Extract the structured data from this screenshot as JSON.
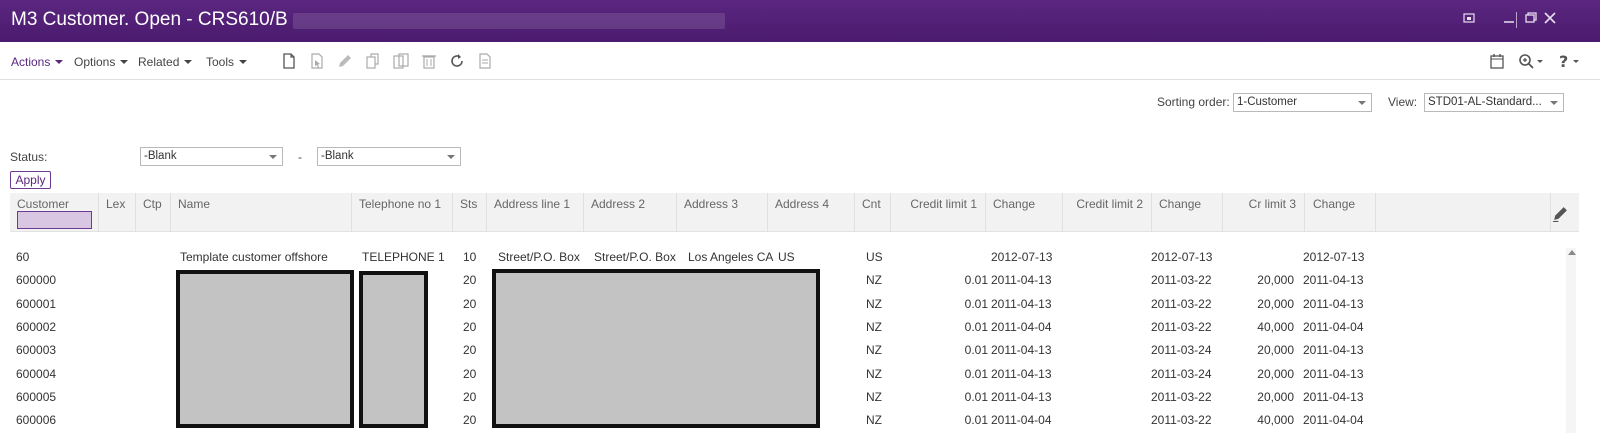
{
  "window": {
    "title": "M3 Customer. Open - CRS610/B"
  },
  "menus": [
    "Actions",
    "Options",
    "Related",
    "Tools"
  ],
  "toolbar_icons": [
    "new-icon",
    "open-icon",
    "edit-icon",
    "copy-icon",
    "copy-alt-icon",
    "delete-icon",
    "refresh-icon",
    "display-icon"
  ],
  "right_icons": [
    "calendar-icon",
    "zoom-icon",
    "help-icon"
  ],
  "sorting": {
    "label": "Sorting order:",
    "value": "1-Customer"
  },
  "view": {
    "label": "View:",
    "value": "STD01-AL-Standard..."
  },
  "status": {
    "label": "Status:",
    "from": "-Blank",
    "separator": "-",
    "to": "-Blank"
  },
  "apply_label": "Apply",
  "columns": [
    "Customer",
    "Lex",
    "Ctp",
    "Name",
    "Telephone no 1",
    "Sts",
    "Address line 1",
    "Address 2",
    "Address 3",
    "Address 4",
    "Cnt",
    "Credit limit 1",
    "Change",
    "Credit limit 2",
    "Change",
    "Cr limit 3",
    "Change"
  ],
  "rows": [
    {
      "customer": "60",
      "name": "Template customer offshore",
      "phone": "TELEPHONE 1",
      "sts": "10",
      "addr1": "Street/P.O. Box",
      "addr2": "Street/P.O. Box",
      "addr3": "Los Angeles CA",
      "addr4": "US",
      "cnt": "US",
      "cl1": "",
      "chg1": "2012-07-13",
      "cl2": "",
      "chg2": "2012-07-13",
      "cl3": "",
      "chg3": "2012-07-13"
    },
    {
      "customer": "600000",
      "name": "",
      "phone": "",
      "sts": "20",
      "addr1": "",
      "addr2": "",
      "addr3": "",
      "addr4": "",
      "cnt": "NZ",
      "cl1": "0.01",
      "chg1": "2011-04-13",
      "cl2": "",
      "chg2": "2011-03-22",
      "cl3": "20,000",
      "chg3": "2011-04-13"
    },
    {
      "customer": "600001",
      "name": "",
      "phone": "",
      "sts": "20",
      "addr1": "",
      "addr2": "",
      "addr3": "",
      "addr4": "",
      "cnt": "NZ",
      "cl1": "0.01",
      "chg1": "2011-04-13",
      "cl2": "",
      "chg2": "2011-03-22",
      "cl3": "20,000",
      "chg3": "2011-04-13"
    },
    {
      "customer": "600002",
      "name": "",
      "phone": "",
      "sts": "20",
      "addr1": "",
      "addr2": "",
      "addr3": "",
      "addr4": "",
      "cnt": "NZ",
      "cl1": "0.01",
      "chg1": "2011-04-04",
      "cl2": "",
      "chg2": "2011-03-22",
      "cl3": "40,000",
      "chg3": "2011-04-04"
    },
    {
      "customer": "600003",
      "name": "",
      "phone": "",
      "sts": "20",
      "addr1": "",
      "addr2": "",
      "addr3": "",
      "addr4": "",
      "cnt": "NZ",
      "cl1": "0.01",
      "chg1": "2011-04-13",
      "cl2": "",
      "chg2": "2011-03-24",
      "cl3": "20,000",
      "chg3": "2011-04-13"
    },
    {
      "customer": "600004",
      "name": "",
      "phone": "",
      "sts": "20",
      "addr1": "",
      "addr2": "",
      "addr3": "",
      "addr4": "",
      "cnt": "NZ",
      "cl1": "0.01",
      "chg1": "2011-04-13",
      "cl2": "",
      "chg2": "2011-03-24",
      "cl3": "20,000",
      "chg3": "2011-04-13"
    },
    {
      "customer": "600005",
      "name": "",
      "phone": "",
      "sts": "20",
      "addr1": "",
      "addr2": "",
      "addr3": "",
      "addr4": "",
      "cnt": "NZ",
      "cl1": "0.01",
      "chg1": "2011-04-13",
      "cl2": "",
      "chg2": "2011-03-22",
      "cl3": "20,000",
      "chg3": "2011-04-13"
    },
    {
      "customer": "600006",
      "name": "",
      "phone": "",
      "sts": "20",
      "addr1": "",
      "addr2": "",
      "addr3": "",
      "addr4": "",
      "cnt": "NZ",
      "cl1": "0.01",
      "chg1": "2011-04-04",
      "cl2": "",
      "chg2": "2011-03-22",
      "cl3": "40,000",
      "chg3": "2011-04-04"
    }
  ],
  "colors": {
    "accent": "#5b2680",
    "titlebar": "#4a1b6e",
    "redaction": "#c3c3c3"
  }
}
